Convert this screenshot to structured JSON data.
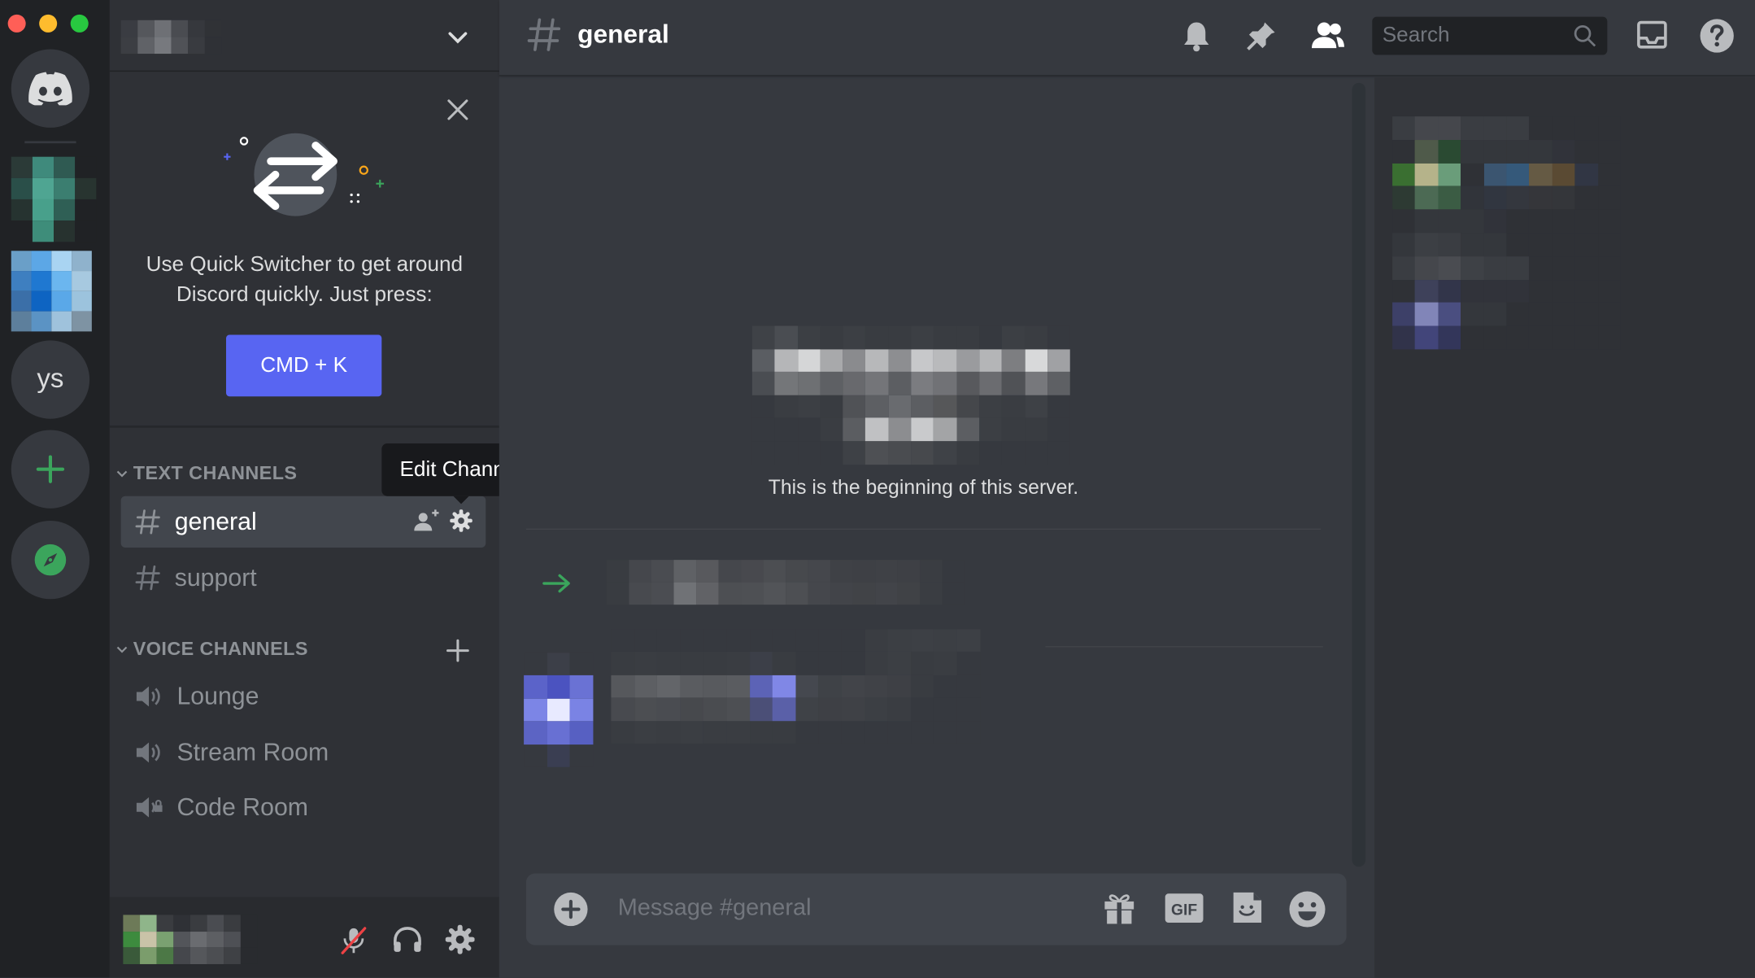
{
  "sidebar": {
    "quick_switcher": {
      "text": "Use Quick Switcher to get around Discord quickly. Just press:",
      "button_label": "CMD + K"
    },
    "text_category": "TEXT CHANNELS",
    "voice_category": "VOICE CHANNELS",
    "text_channels": [
      "general",
      "support"
    ],
    "voice_channels": [
      "Lounge",
      "Stream Room",
      "Code Room"
    ],
    "tooltip": "Edit Channel"
  },
  "servers": [
    {
      "icon": "discord-home-icon"
    },
    {
      "label": "ys"
    },
    {
      "icon": "add-server-icon"
    },
    {
      "icon": "explore-compass-icon"
    }
  ],
  "main": {
    "channel_title": "general",
    "search_placeholder": "Search",
    "welcome_text": "This is the beginning of this server.",
    "composer_placeholder": "Message #general"
  },
  "colors": {
    "accent": "#5865f2",
    "online_green": "#3ba55c",
    "rail_bg": "#202225",
    "sidebar_bg": "#2f3136",
    "main_bg": "#36393f"
  }
}
